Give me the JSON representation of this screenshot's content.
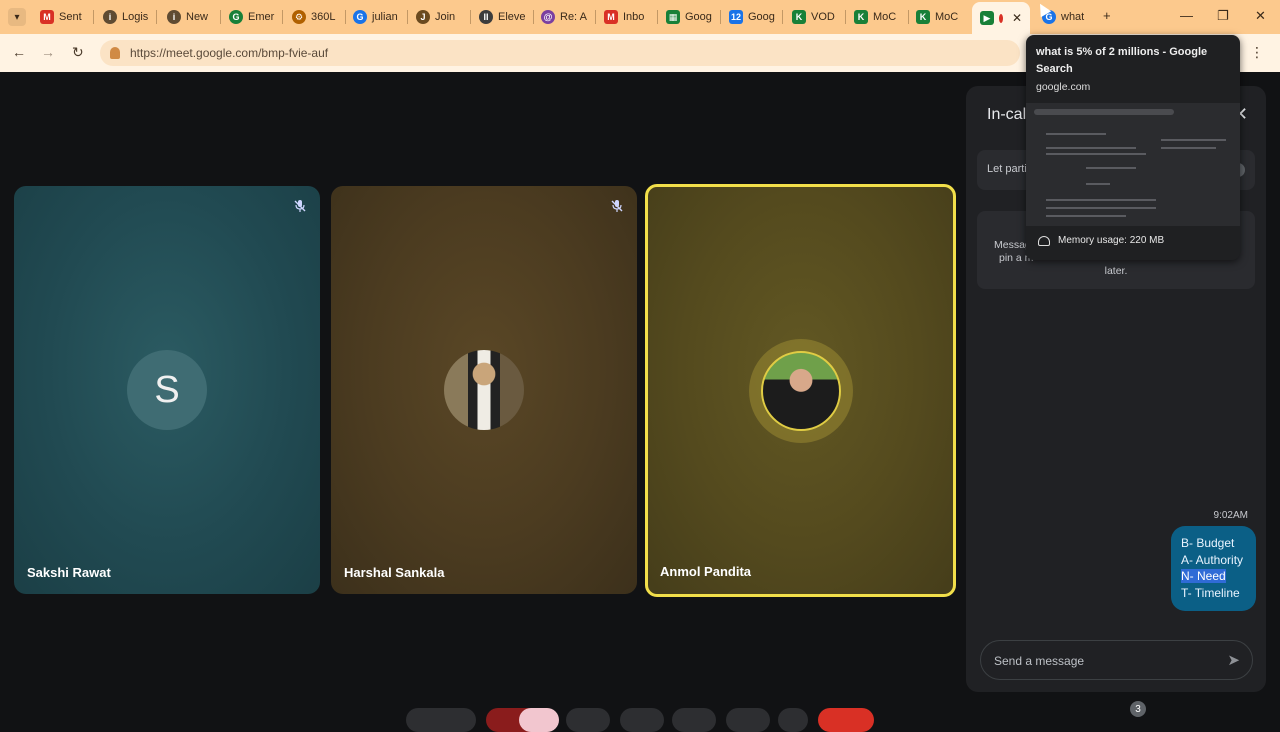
{
  "browser": {
    "tabs": [
      {
        "label": "Sent",
        "favicon": "gmail-icon",
        "color": "#d93025"
      },
      {
        "label": "Logis",
        "favicon": "info-icon",
        "color": "#5f4b32"
      },
      {
        "label": "New",
        "favicon": "info-icon",
        "color": "#5f4b32"
      },
      {
        "label": "Emer",
        "favicon": "grammarly-icon",
        "color": "#188038"
      },
      {
        "label": "360L",
        "favicon": "settings-icon",
        "color": "#b06000"
      },
      {
        "label": "julian",
        "favicon": "google-icon",
        "color": "#1a73e8"
      },
      {
        "label": "Join",
        "favicon": "join-icon",
        "color": "#6b4a1f"
      },
      {
        "label": "Eleve",
        "favicon": "pause-icon",
        "color": "#3c3c3c"
      },
      {
        "label": "Re: A",
        "favicon": "purple-icon",
        "color": "#7b3fa0"
      },
      {
        "label": "Inbo",
        "favicon": "gmail-icon",
        "color": "#d93025"
      },
      {
        "label": "Goog",
        "favicon": "google-sheets-icon",
        "color": "#188038"
      },
      {
        "label": "Goog",
        "favicon": "google-calendar-icon",
        "color": "#1a73e8"
      },
      {
        "label": "VOD",
        "favicon": "k-icon",
        "color": "#188038"
      },
      {
        "label": "MoC",
        "favicon": "k-icon",
        "color": "#188038"
      },
      {
        "label": "MoC",
        "favicon": "k-icon",
        "color": "#188038"
      }
    ],
    "active_tab": {
      "favicon": "google-meet-icon",
      "recording": true
    },
    "hover_tab": {
      "label": "what",
      "favicon": "google-icon"
    },
    "url": "https://meet.google.com/bmp-fvie-auf",
    "colors": {
      "tabbar": "#fcc98d",
      "addressbar": "#fff3e3"
    }
  },
  "hover_card": {
    "title": "what is 5% of 2 millions - Google Search",
    "domain": "google.com",
    "memory": "Memory usage: 220 MB"
  },
  "participants": [
    {
      "name": "Sakshi Rawat",
      "initial": "S",
      "muted": true
    },
    {
      "name": "Harshal Sankala",
      "muted": true
    },
    {
      "name": "Anmol Pandita",
      "speaking": true
    }
  ],
  "panel": {
    "title": "In-cal",
    "let_participants": "Let parti",
    "message_info": "Messag",
    "message_info2": "pin a m",
    "message_info3": "later.",
    "chat": {
      "time": "9:02AM",
      "lines": [
        "B- Budget",
        "A- Authority",
        "N- Need",
        "T- Timeline"
      ]
    },
    "input_placeholder": "Send a message"
  },
  "bottom": {
    "badge_count": "3"
  }
}
